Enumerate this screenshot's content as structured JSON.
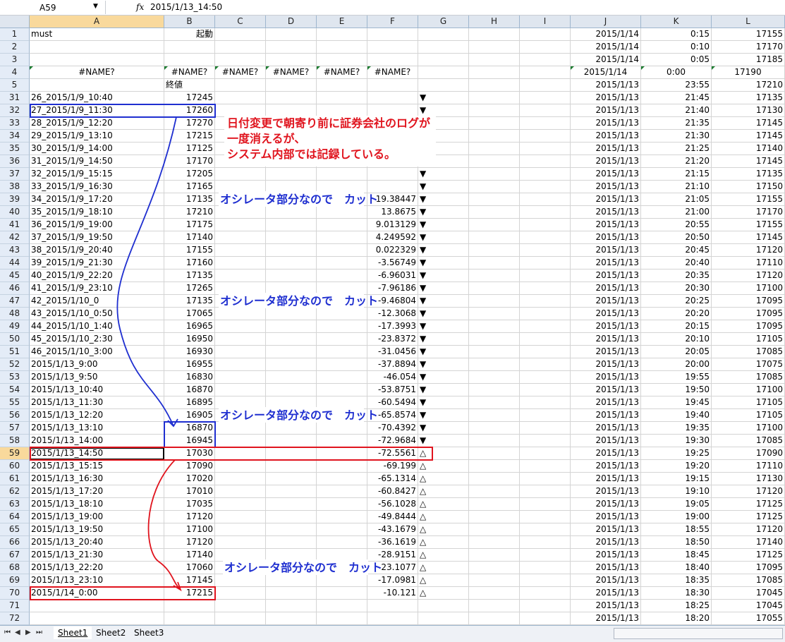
{
  "formula_bar": {
    "name_box": "A59",
    "fx_label": "fx",
    "formula": "2015/1/13_14:50"
  },
  "columns": [
    "A",
    "B",
    "C",
    "D",
    "E",
    "F",
    "G",
    "H",
    "I",
    "J",
    "K",
    "L"
  ],
  "rows": [
    {
      "n": "1",
      "a": "must",
      "b": "起動",
      "f": "",
      "g": "",
      "j": "2015/1/14",
      "k": "0:15",
      "l": "17155"
    },
    {
      "n": "2",
      "a": "",
      "b": "",
      "f": "",
      "g": "",
      "j": "2015/1/14",
      "k": "0:10",
      "l": "17170"
    },
    {
      "n": "3",
      "a": "",
      "b": "",
      "f": "",
      "g": "",
      "j": "2015/1/14",
      "k": "0:05",
      "l": "17185"
    },
    {
      "n": "4",
      "a": "#NAME?",
      "b": "#NAME?",
      "c": "#NAME?",
      "d": "#NAME?",
      "e": "#NAME?",
      "f": "#NAME?",
      "g": "",
      "j": "2015/1/14",
      "k": "0:00",
      "l": "17190"
    },
    {
      "n": "5",
      "a": "",
      "b": "終値",
      "f": "",
      "g": "",
      "j": "2015/1/13",
      "k": "23:55",
      "l": "17210"
    },
    {
      "n": "31",
      "a": "26_2015/1/9_10:40",
      "b": "17245",
      "f": "",
      "g": "▼",
      "j": "2015/1/13",
      "k": "21:45",
      "l": "17135"
    },
    {
      "n": "32",
      "a": "27_2015/1/9_11:30",
      "b": "17260",
      "f": "",
      "g": "▼",
      "j": "2015/1/13",
      "k": "21:40",
      "l": "17130"
    },
    {
      "n": "33",
      "a": "28_2015/1/9_12:20",
      "b": "17270",
      "f": "",
      "g": "▼",
      "j": "2015/1/13",
      "k": "21:35",
      "l": "17145"
    },
    {
      "n": "34",
      "a": "29_2015/1/9_13:10",
      "b": "17215",
      "f": "",
      "g": "▼",
      "j": "2015/1/13",
      "k": "21:30",
      "l": "17145"
    },
    {
      "n": "35",
      "a": "30_2015/1/9_14:00",
      "b": "17125",
      "f": "",
      "g": "▼",
      "j": "2015/1/13",
      "k": "21:25",
      "l": "17140"
    },
    {
      "n": "36",
      "a": "31_2015/1/9_14:50",
      "b": "17170",
      "f": "",
      "g": "▼",
      "j": "2015/1/13",
      "k": "21:20",
      "l": "17145"
    },
    {
      "n": "37",
      "a": "32_2015/1/9_15:15",
      "b": "17205",
      "f": "",
      "g": "▼",
      "j": "2015/1/13",
      "k": "21:15",
      "l": "17135"
    },
    {
      "n": "38",
      "a": "33_2015/1/9_16:30",
      "b": "17165",
      "f": "",
      "g": "▼",
      "j": "2015/1/13",
      "k": "21:10",
      "l": "17150"
    },
    {
      "n": "39",
      "a": "34_2015/1/9_17:20",
      "b": "17135",
      "f": "19.38447",
      "g": "▼",
      "j": "2015/1/13",
      "k": "21:05",
      "l": "17155"
    },
    {
      "n": "40",
      "a": "35_2015/1/9_18:10",
      "b": "17210",
      "f": "13.8675",
      "g": "▼",
      "j": "2015/1/13",
      "k": "21:00",
      "l": "17170"
    },
    {
      "n": "41",
      "a": "36_2015/1/9_19:00",
      "b": "17175",
      "f": "9.013129",
      "g": "▼",
      "j": "2015/1/13",
      "k": "20:55",
      "l": "17155"
    },
    {
      "n": "42",
      "a": "37_2015/1/9_19:50",
      "b": "17140",
      "f": "4.249592",
      "g": "▼",
      "j": "2015/1/13",
      "k": "20:50",
      "l": "17145"
    },
    {
      "n": "43",
      "a": "38_2015/1/9_20:40",
      "b": "17155",
      "f": "0.022329",
      "g": "▼",
      "j": "2015/1/13",
      "k": "20:45",
      "l": "17120"
    },
    {
      "n": "44",
      "a": "39_2015/1/9_21:30",
      "b": "17160",
      "f": "-3.56749",
      "g": "▼",
      "j": "2015/1/13",
      "k": "20:40",
      "l": "17110"
    },
    {
      "n": "45",
      "a": "40_2015/1/9_22:20",
      "b": "17135",
      "f": "-6.96031",
      "g": "▼",
      "j": "2015/1/13",
      "k": "20:35",
      "l": "17120"
    },
    {
      "n": "46",
      "a": "41_2015/1/9_23:10",
      "b": "17265",
      "f": "-7.96186",
      "g": "▼",
      "j": "2015/1/13",
      "k": "20:30",
      "l": "17100"
    },
    {
      "n": "47",
      "a": "42_2015/1/10_0",
      "b": "17135",
      "f": "-9.46804",
      "g": "▼",
      "j": "2015/1/13",
      "k": "20:25",
      "l": "17095"
    },
    {
      "n": "48",
      "a": "43_2015/1/10_0:50",
      "b": "17065",
      "f": "-12.3068",
      "g": "▼",
      "j": "2015/1/13",
      "k": "20:20",
      "l": "17095"
    },
    {
      "n": "49",
      "a": "44_2015/1/10_1:40",
      "b": "16965",
      "f": "-17.3993",
      "g": "▼",
      "j": "2015/1/13",
      "k": "20:15",
      "l": "17095"
    },
    {
      "n": "50",
      "a": "45_2015/1/10_2:30",
      "b": "16950",
      "f": "-23.8372",
      "g": "▼",
      "j": "2015/1/13",
      "k": "20:10",
      "l": "17105"
    },
    {
      "n": "51",
      "a": "46_2015/1/10_3:00",
      "b": "16930",
      "f": "-31.0456",
      "g": "▼",
      "j": "2015/1/13",
      "k": "20:05",
      "l": "17085"
    },
    {
      "n": "52",
      "a": "2015/1/13_9:00",
      "b": "16955",
      "f": "-37.8894",
      "g": "▼",
      "j": "2015/1/13",
      "k": "20:00",
      "l": "17075"
    },
    {
      "n": "53",
      "a": "2015/1/13_9:50",
      "b": "16830",
      "f": "-46.054",
      "g": "▼",
      "j": "2015/1/13",
      "k": "19:55",
      "l": "17085"
    },
    {
      "n": "54",
      "a": "2015/1/13_10:40",
      "b": "16870",
      "f": "-53.8751",
      "g": "▼",
      "j": "2015/1/13",
      "k": "19:50",
      "l": "17100"
    },
    {
      "n": "55",
      "a": "2015/1/13_11:30",
      "b": "16895",
      "f": "-60.5494",
      "g": "▼",
      "j": "2015/1/13",
      "k": "19:45",
      "l": "17105"
    },
    {
      "n": "56",
      "a": "2015/1/13_12:20",
      "b": "16905",
      "f": "-65.8574",
      "g": "▼",
      "j": "2015/1/13",
      "k": "19:40",
      "l": "17105"
    },
    {
      "n": "57",
      "a": "2015/1/13_13:10",
      "b": "16870",
      "f": "-70.4392",
      "g": "▼",
      "j": "2015/1/13",
      "k": "19:35",
      "l": "17100"
    },
    {
      "n": "58",
      "a": "2015/1/13_14:00",
      "b": "16945",
      "f": "-72.9684",
      "g": "▼",
      "j": "2015/1/13",
      "k": "19:30",
      "l": "17085"
    },
    {
      "n": "59",
      "a": "2015/1/13_14:50",
      "b": "17030",
      "f": "-72.5561",
      "g": "△",
      "j": "2015/1/13",
      "k": "19:25",
      "l": "17090"
    },
    {
      "n": "60",
      "a": "2015/1/13_15:15",
      "b": "17090",
      "f": "-69.199",
      "g": "△",
      "j": "2015/1/13",
      "k": "19:20",
      "l": "17110"
    },
    {
      "n": "61",
      "a": "2015/1/13_16:30",
      "b": "17020",
      "f": "-65.1314",
      "g": "△",
      "j": "2015/1/13",
      "k": "19:15",
      "l": "17130"
    },
    {
      "n": "62",
      "a": "2015/1/13_17:20",
      "b": "17010",
      "f": "-60.8427",
      "g": "△",
      "j": "2015/1/13",
      "k": "19:10",
      "l": "17120"
    },
    {
      "n": "63",
      "a": "2015/1/13_18:10",
      "b": "17035",
      "f": "-56.1028",
      "g": "△",
      "j": "2015/1/13",
      "k": "19:05",
      "l": "17125"
    },
    {
      "n": "64",
      "a": "2015/1/13_19:00",
      "b": "17120",
      "f": "-49.8444",
      "g": "△",
      "j": "2015/1/13",
      "k": "19:00",
      "l": "17125"
    },
    {
      "n": "65",
      "a": "2015/1/13_19:50",
      "b": "17100",
      "f": "-43.1679",
      "g": "△",
      "j": "2015/1/13",
      "k": "18:55",
      "l": "17120"
    },
    {
      "n": "66",
      "a": "2015/1/13_20:40",
      "b": "17120",
      "f": "-36.1619",
      "g": "△",
      "j": "2015/1/13",
      "k": "18:50",
      "l": "17140"
    },
    {
      "n": "67",
      "a": "2015/1/13_21:30",
      "b": "17140",
      "f": "-28.9151",
      "g": "△",
      "j": "2015/1/13",
      "k": "18:45",
      "l": "17125"
    },
    {
      "n": "68",
      "a": "2015/1/13_22:20",
      "b": "17060",
      "f": "-23.1077",
      "g": "△",
      "j": "2015/1/13",
      "k": "18:40",
      "l": "17095"
    },
    {
      "n": "69",
      "a": "2015/1/13_23:10",
      "b": "17145",
      "f": "-17.0981",
      "g": "△",
      "j": "2015/1/13",
      "k": "18:35",
      "l": "17085"
    },
    {
      "n": "70",
      "a": "2015/1/14_0:00",
      "b": "17215",
      "f": "-10.121",
      "g": "△",
      "j": "2015/1/13",
      "k": "18:30",
      "l": "17045"
    },
    {
      "n": "71",
      "a": "",
      "b": "",
      "f": "",
      "g": "",
      "j": "2015/1/13",
      "k": "18:25",
      "l": "17045"
    },
    {
      "n": "72",
      "a": "",
      "b": "",
      "f": "",
      "g": "",
      "j": "2015/1/13",
      "k": "18:20",
      "l": "17055"
    }
  ],
  "annotations": {
    "red_note": [
      "日付変更で朝寄り前に証券会社のログが",
      "一度消えるが、",
      "システム内部では記録している。"
    ],
    "cut_note": "オシレータ部分なので　カット",
    "colors": {
      "red": "#e0141e",
      "blue": "#1f2fd0"
    }
  },
  "tabs": {
    "nav": [
      "⏮",
      "◀",
      "▶",
      "⏭"
    ],
    "sheets": [
      "Sheet1",
      "Sheet2",
      "Sheet3"
    ],
    "active": 0
  }
}
